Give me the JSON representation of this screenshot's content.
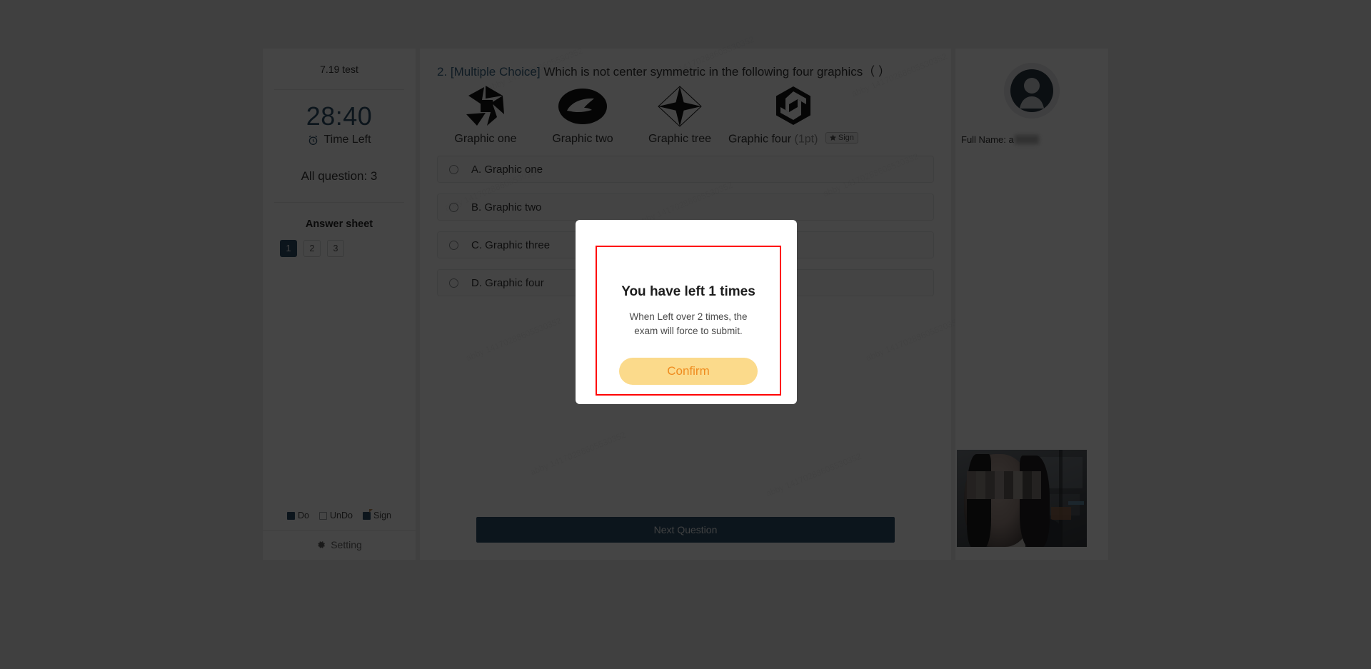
{
  "sidebar": {
    "exam_title": "7.19 test",
    "timer": "28:40",
    "timer_label": "Time Left",
    "all_question": "All question: 3",
    "answer_sheet_title": "Answer sheet",
    "question_numbers": [
      {
        "label": "1",
        "state": "active"
      },
      {
        "label": "2",
        "state": "undone"
      },
      {
        "label": "3",
        "state": "undone"
      }
    ],
    "legend": [
      {
        "label": "Do",
        "type": "done"
      },
      {
        "label": "UnDo",
        "type": "undone"
      },
      {
        "label": "Sign",
        "type": "sign"
      }
    ],
    "setting_label": "Setting"
  },
  "question": {
    "number": "2.",
    "type_tag": "[Multiple Choice]",
    "text": "Which is not center symmetric in the following four graphics（   ）",
    "graphics": [
      {
        "label": "Graphic one",
        "icon": "pinwheel-squares-icon"
      },
      {
        "label": "Graphic two",
        "icon": "oval-swoosh-icon"
      },
      {
        "label": "Graphic three_display",
        "display_label": "Graphic tree",
        "icon": "four-point-star-diamond-icon"
      },
      {
        "label": "Graphic four",
        "display_label": "Graphic four",
        "icon": "hexagon-spiral-icon",
        "points": "(1pt)",
        "badge": "Sign"
      }
    ],
    "options": [
      {
        "key": "A",
        "label": "A. Graphic one",
        "selected": false
      },
      {
        "key": "B",
        "label": "B. Graphic two",
        "selected": false
      },
      {
        "key": "C",
        "label": "C. Graphic three",
        "selected": false
      },
      {
        "key": "D",
        "label": "D. Graphic four",
        "selected": false
      }
    ],
    "next_button": "Next Question"
  },
  "right_panel": {
    "full_name_label": "Full Name:",
    "full_name_value": "a"
  },
  "modal": {
    "title": "You have left 1 times",
    "message": "When Left over 2 times, the exam will force to submit.",
    "confirm_label": "Confirm"
  },
  "colors": {
    "accent": "#16537e",
    "modal_border": "#ff0000",
    "confirm_bg": "#fbda8b",
    "confirm_text": "#ef8b1e",
    "tag": "#1b6ca8"
  },
  "watermark_text": "abby 14170288605530352"
}
